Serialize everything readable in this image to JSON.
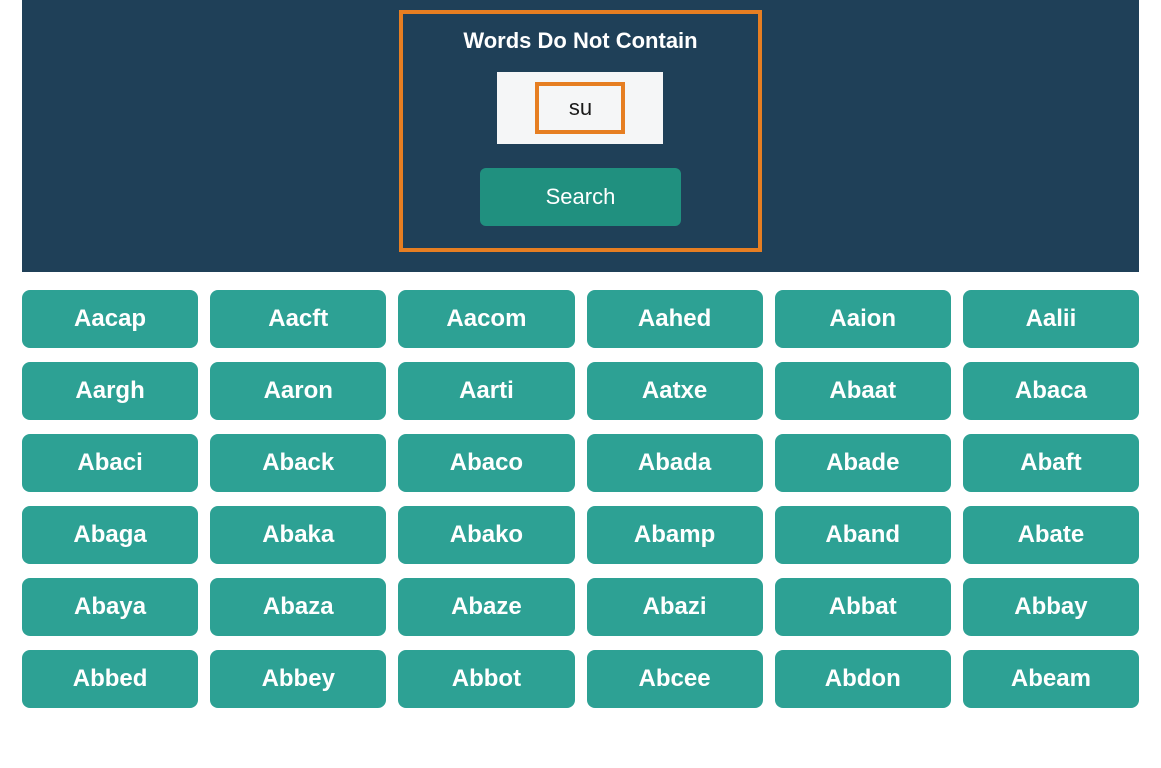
{
  "search": {
    "title": "Words Do Not Contain",
    "input_value": "su",
    "button_label": "Search"
  },
  "words": [
    "Aacap",
    "Aacft",
    "Aacom",
    "Aahed",
    "Aaion",
    "Aalii",
    "Aargh",
    "Aaron",
    "Aarti",
    "Aatxe",
    "Abaat",
    "Abaca",
    "Abaci",
    "Aback",
    "Abaco",
    "Abada",
    "Abade",
    "Abaft",
    "Abaga",
    "Abaka",
    "Abako",
    "Abamp",
    "Aband",
    "Abate",
    "Abaya",
    "Abaza",
    "Abaze",
    "Abazi",
    "Abbat",
    "Abbay",
    "Abbed",
    "Abbey",
    "Abbot",
    "Abcee",
    "Abdon",
    "Abeam"
  ]
}
